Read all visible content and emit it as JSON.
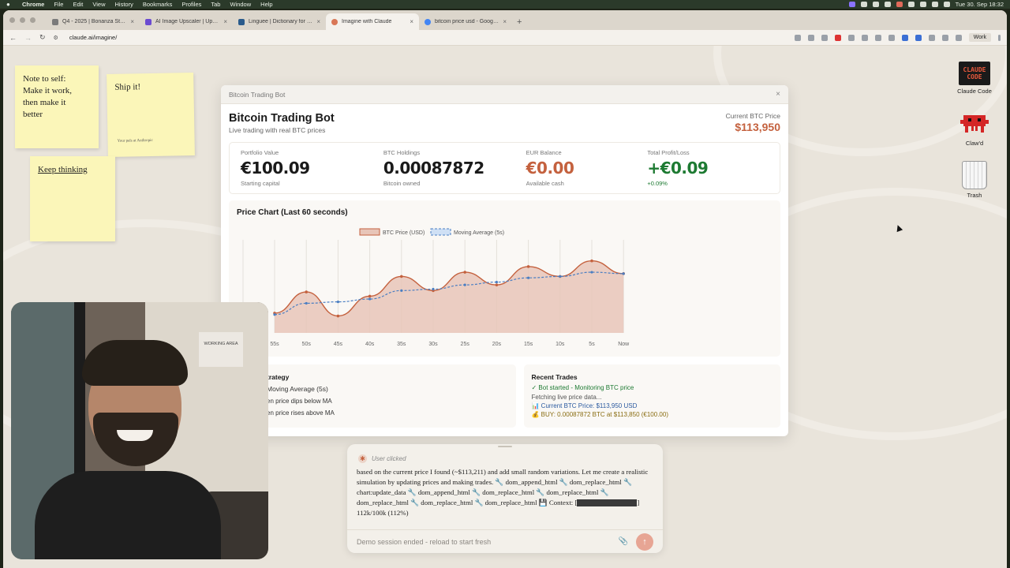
{
  "menubar": {
    "app": "Chrome",
    "items": [
      "File",
      "Edit",
      "View",
      "History",
      "Bookmarks",
      "Profiles",
      "Tab",
      "Window",
      "Help"
    ],
    "clock": "Tue 30. Sep 18:32"
  },
  "tabs": [
    {
      "title": "Q4 - 2025 | Bonanza Studio",
      "active": false
    },
    {
      "title": "AI Image Upscaler | Upscale",
      "active": false
    },
    {
      "title": "Linguee | Dictionary for German",
      "active": false
    },
    {
      "title": "Imagine with Claude",
      "active": true
    },
    {
      "title": "bitcoin price usd - Google Search",
      "active": false
    }
  ],
  "toolbar": {
    "url": "claude.ai/imagine/",
    "profile": "Work"
  },
  "stickies": [
    {
      "lines": [
        "Note to self:",
        "Make it work,",
        "then make it",
        "better"
      ]
    },
    {
      "lines": [
        "Ship it!"
      ],
      "tiny": "Your pals at Anthropic"
    },
    {
      "lines": [
        "Keep thinking"
      ]
    }
  ],
  "desktop": {
    "claude_code_logo": "CLAUDE CODE",
    "claude_code_label": "Claude Code",
    "clawd_label": "Claw'd",
    "trash_label": "Trash"
  },
  "app": {
    "window_title": "Bitcoin Trading Bot",
    "title": "Bitcoin Trading Bot",
    "subtitle": "Live trading with real BTC prices",
    "price_label": "Current BTC Price",
    "price_value": "$113,950",
    "stats": [
      {
        "label": "Portfolio Value",
        "value": "€100.09",
        "note": "Starting capital",
        "tone": "dark"
      },
      {
        "label": "BTC Holdings",
        "value": "0.00087872",
        "note": "Bitcoin owned",
        "tone": "dark"
      },
      {
        "label": "EUR Balance",
        "value": "€0.00",
        "note": "Available cash",
        "tone": "orange"
      },
      {
        "label": "Total Profit/Loss",
        "value": "+€0.09",
        "note": "+0.09%",
        "tone": "green"
      }
    ],
    "chart_title": "Price Chart (Last 60 seconds)",
    "strategy": {
      "title": "trategy",
      "lines": [
        "Moving Average (5s)",
        "en price dips below MA",
        "en price rises above MA"
      ]
    },
    "trades": {
      "title": "Recent Trades",
      "lines": [
        "✓ Bot started - Monitoring BTC price",
        "Fetching live price data...",
        "📊 Current BTC Price: $113,950 USD",
        "💰 BUY: 0.00087872 BTC at $113,850 (€100.00)"
      ]
    }
  },
  "chart_data": {
    "type": "area",
    "title": "Price Chart (Last 60 seconds)",
    "categories": [
      "55s",
      "50s",
      "45s",
      "40s",
      "35s",
      "30s",
      "25s",
      "20s",
      "15s",
      "10s",
      "5s",
      "Now"
    ],
    "series": [
      {
        "name": "BTC Price (USD)",
        "values": [
          113520,
          113670,
          113500,
          113640,
          113780,
          113680,
          113810,
          113720,
          113850,
          113780,
          113890,
          113800
        ],
        "color": "#c4613e",
        "fill": "#e8c5b8"
      },
      {
        "name": "Moving Average (5s)",
        "values": [
          113510,
          113590,
          113600,
          113620,
          113680,
          113690,
          113720,
          113740,
          113770,
          113780,
          113810,
          113800
        ],
        "color": "#4a7ec2",
        "dashed": true
      }
    ],
    "ylim": [
      113380,
      113950
    ],
    "grid": true,
    "legend": "top"
  },
  "chat": {
    "clicked": "User clicked",
    "message_1": "based on the current price I found (~$113,211) and add small random variations. Let me create a realistic simulation by updating prices and making trades. 🔧 dom_append_html 🔧 dom_replace_html 🔧 chart:update_data 🔧 dom_append_html 🔧 dom_replace_html 🔧 dom_replace_html 🔧 dom_replace_html 🔧 dom_replace_html 🔧 dom_replace_html 💾 Context: [",
    "message_2": "] 112k/100k (112%)",
    "placeholder": "Demo session ended - reload to start fresh"
  },
  "webcam": {
    "sign": "WORKING AREA"
  }
}
